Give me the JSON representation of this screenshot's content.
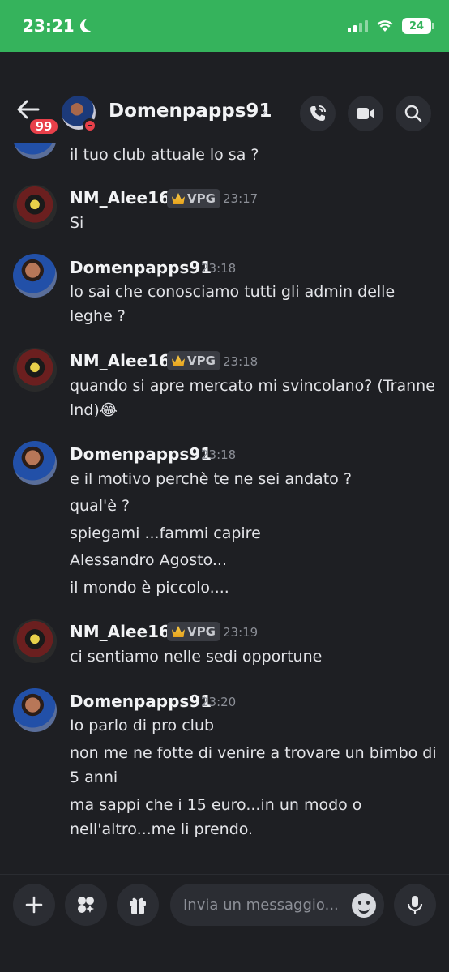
{
  "status_bar": {
    "time": "23:21",
    "battery": "24"
  },
  "header": {
    "unread_badge": "99",
    "title": "Domenpapps91",
    "chevron": "›",
    "icons": [
      "back-arrow-icon",
      "phone-call-icon",
      "video-camera-icon",
      "search-icon"
    ]
  },
  "messages": {
    "partial_line": "il tuo club attuale lo sa ?",
    "groups": [
      {
        "author": "NM_Alee16",
        "tag": "VPG",
        "time": "23:17",
        "lines": [
          "Si"
        ]
      },
      {
        "author": "Domenpapps91",
        "time": "23:18",
        "lines": [
          "lo sai che conosciamo tutti gli admin delle",
          "leghe ?"
        ]
      },
      {
        "author": "NM_Alee16",
        "tag": "VPG",
        "time": "23:18",
        "lines": [
          "quando si apre mercato mi svincolano? (Tranne",
          "lnd)😂"
        ]
      },
      {
        "author": "Domenpapps91",
        "time": "23:18",
        "lines": [
          "e il motivo perchè te  ne sei andato ?",
          "qual'è ?",
          "spiegami ...fammi capire",
          "Alessandro Agosto...",
          "il mondo è piccolo...."
        ]
      },
      {
        "author": "NM_Alee16",
        "tag": "VPG",
        "time": "23:19",
        "lines": [
          "ci sentiamo nelle sedi opportune"
        ]
      },
      {
        "author": "Domenpapps91",
        "time": "23:20",
        "lines": [
          "Io parlo di pro club",
          "non me ne fotte di venire a trovare un bimbo di",
          "5 anni",
          "ma sappi che i 15 euro...in un modo o",
          "nell'altro...me li prendo."
        ]
      }
    ]
  },
  "composer": {
    "placeholder": "Invia un messaggio...",
    "icons": [
      "plus-icon",
      "apps-icon",
      "gift-icon",
      "emoji-icon",
      "microphone-icon"
    ]
  },
  "colors": {
    "status_bar": "#35b35c",
    "background": "#1e1f23",
    "badge": "#e8404a"
  }
}
